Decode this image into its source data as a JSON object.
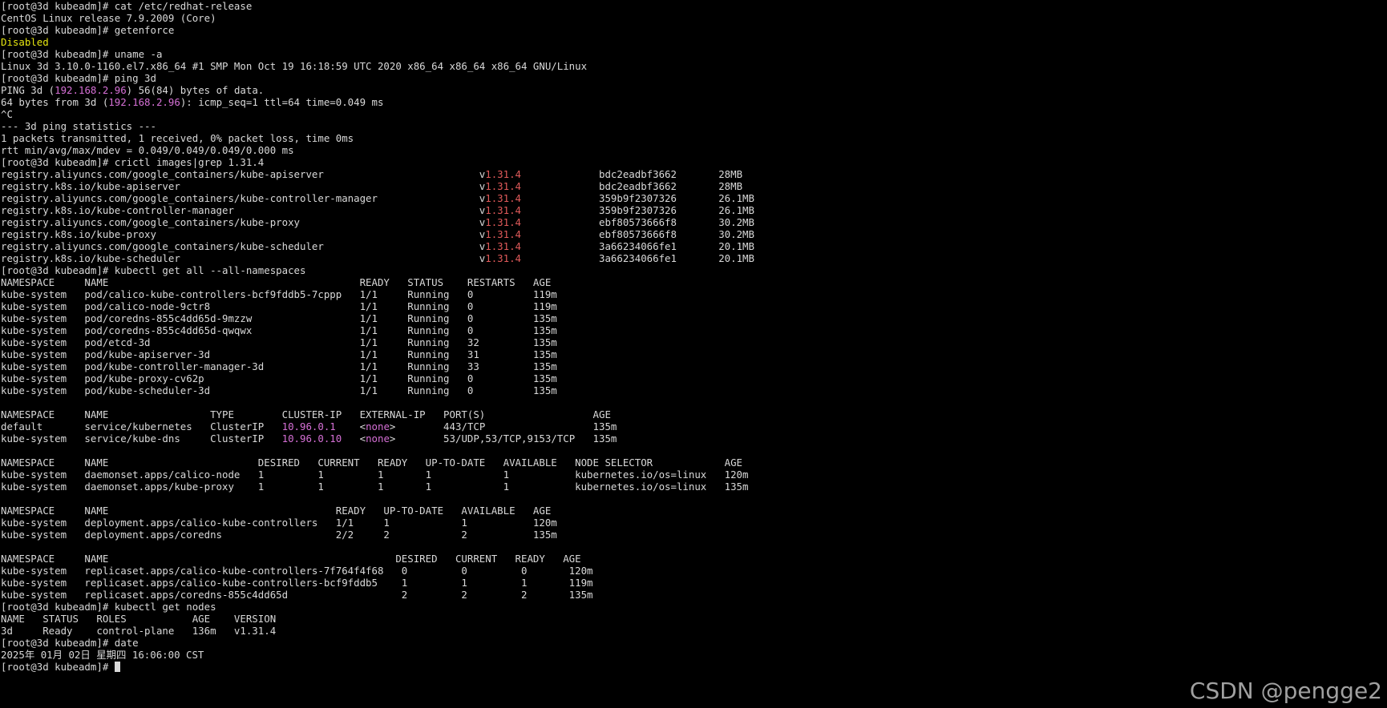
{
  "terminal": {
    "lines": [
      [
        [
          "[root@3d kubeadm]# cat /etc/redhat-release",
          ""
        ]
      ],
      [
        [
          "CentOS Linux release 7.9.2009 (Core)",
          ""
        ]
      ],
      [
        [
          "[root@3d kubeadm]# getenforce",
          ""
        ]
      ],
      [
        [
          "Disabled",
          "yellow"
        ]
      ],
      [
        [
          "[root@3d kubeadm]# uname -a",
          ""
        ]
      ],
      [
        [
          "Linux 3d 3.10.0-1160.el7.x86_64 #1 SMP Mon Oct 19 16:18:59 UTC 2020 x86_64 x86_64 x86_64 GNU/Linux",
          ""
        ]
      ],
      [
        [
          "[root@3d kubeadm]# ping 3d",
          ""
        ]
      ],
      [
        [
          "PING 3d (",
          ""
        ],
        [
          "192.168.2.96",
          "magenta"
        ],
        [
          ") 56(84) bytes of data.",
          ""
        ]
      ],
      [
        [
          "64 bytes from 3d (",
          ""
        ],
        [
          "192.168.2.96",
          "magenta"
        ],
        [
          "): icmp_seq=1 ttl=64 time=0.049 ms",
          ""
        ]
      ],
      [
        [
          "^C",
          ""
        ]
      ],
      [
        [
          "--- 3d ping statistics ---",
          ""
        ]
      ],
      [
        [
          "1 packets transmitted, 1 received, 0% packet loss, time 0ms",
          ""
        ]
      ],
      [
        [
          "rtt min/avg/max/mdev = 0.049/0.049/0.049/0.000 ms",
          ""
        ]
      ],
      [
        [
          "[root@3d kubeadm]# crictl images|grep 1.31.4",
          ""
        ]
      ],
      [
        [
          "registry.aliyuncs.com/google_containers/kube-apiserver                          v",
          ""
        ],
        [
          "1.31.4",
          "red"
        ],
        [
          "             bdc2eadbf3662       28MB",
          ""
        ]
      ],
      [
        [
          "registry.k8s.io/kube-apiserver                                                  v",
          ""
        ],
        [
          "1.31.4",
          "red"
        ],
        [
          "             bdc2eadbf3662       28MB",
          ""
        ]
      ],
      [
        [
          "registry.aliyuncs.com/google_containers/kube-controller-manager                 v",
          ""
        ],
        [
          "1.31.4",
          "red"
        ],
        [
          "             359b9f2307326       26.1MB",
          ""
        ]
      ],
      [
        [
          "registry.k8s.io/kube-controller-manager                                         v",
          ""
        ],
        [
          "1.31.4",
          "red"
        ],
        [
          "             359b9f2307326       26.1MB",
          ""
        ]
      ],
      [
        [
          "registry.aliyuncs.com/google_containers/kube-proxy                              v",
          ""
        ],
        [
          "1.31.4",
          "red"
        ],
        [
          "             ebf80573666f8       30.2MB",
          ""
        ]
      ],
      [
        [
          "registry.k8s.io/kube-proxy                                                      v",
          ""
        ],
        [
          "1.31.4",
          "red"
        ],
        [
          "             ebf80573666f8       30.2MB",
          ""
        ]
      ],
      [
        [
          "registry.aliyuncs.com/google_containers/kube-scheduler                          v",
          ""
        ],
        [
          "1.31.4",
          "red"
        ],
        [
          "             3a66234066fe1       20.1MB",
          ""
        ]
      ],
      [
        [
          "registry.k8s.io/kube-scheduler                                                  v",
          ""
        ],
        [
          "1.31.4",
          "red"
        ],
        [
          "             3a66234066fe1       20.1MB",
          ""
        ]
      ],
      [
        [
          "[root@3d kubeadm]# kubectl get all --all-namespaces",
          ""
        ]
      ],
      [
        [
          "NAMESPACE     NAME                                          READY   STATUS    RESTARTS   AGE",
          ""
        ]
      ],
      [
        [
          "kube-system   pod/calico-kube-controllers-bcf9fddb5-7cppp   1/1     Running   0          119m",
          ""
        ]
      ],
      [
        [
          "kube-system   pod/calico-node-9ctr8                         1/1     Running   0          119m",
          ""
        ]
      ],
      [
        [
          "kube-system   pod/coredns-855c4dd65d-9mzzw                  1/1     Running   0          135m",
          ""
        ]
      ],
      [
        [
          "kube-system   pod/coredns-855c4dd65d-qwqwx                  1/1     Running   0          135m",
          ""
        ]
      ],
      [
        [
          "kube-system   pod/etcd-3d                                   1/1     Running   32         135m",
          ""
        ]
      ],
      [
        [
          "kube-system   pod/kube-apiserver-3d                         1/1     Running   31         135m",
          ""
        ]
      ],
      [
        [
          "kube-system   pod/kube-controller-manager-3d                1/1     Running   33         135m",
          ""
        ]
      ],
      [
        [
          "kube-system   pod/kube-proxy-cv62p                          1/1     Running   0          135m",
          ""
        ]
      ],
      [
        [
          "kube-system   pod/kube-scheduler-3d                         1/1     Running   0          135m",
          ""
        ]
      ],
      [
        [
          "",
          ""
        ]
      ],
      [
        [
          "NAMESPACE     NAME                 TYPE        CLUSTER-IP   EXTERNAL-IP   PORT(S)                  AGE",
          ""
        ]
      ],
      [
        [
          "default       service/kubernetes   ClusterIP   ",
          ""
        ],
        [
          "10.96.0.1",
          "magenta"
        ],
        [
          "    <",
          ""
        ],
        [
          "none",
          "magenta"
        ],
        [
          ">        443/TCP                  135m",
          ""
        ]
      ],
      [
        [
          "kube-system   service/kube-dns     ClusterIP   ",
          ""
        ],
        [
          "10.96.0.10",
          "magenta"
        ],
        [
          "   <",
          ""
        ],
        [
          "none",
          "magenta"
        ],
        [
          ">        53/UDP,53/TCP,9153/TCP   135m",
          ""
        ]
      ],
      [
        [
          "",
          ""
        ]
      ],
      [
        [
          "NAMESPACE     NAME                         DESIRED   CURRENT   READY   UP-TO-DATE   AVAILABLE   NODE SELECTOR            AGE",
          ""
        ]
      ],
      [
        [
          "kube-system   daemonset.apps/calico-node   1         1         1       1            1           kubernetes.io/os=linux   120m",
          ""
        ]
      ],
      [
        [
          "kube-system   daemonset.apps/kube-proxy    1         1         1       1            1           kubernetes.io/os=linux   135m",
          ""
        ]
      ],
      [
        [
          "",
          ""
        ]
      ],
      [
        [
          "NAMESPACE     NAME                                      READY   UP-TO-DATE   AVAILABLE   AGE",
          ""
        ]
      ],
      [
        [
          "kube-system   deployment.apps/calico-kube-controllers   1/1     1            1           120m",
          ""
        ]
      ],
      [
        [
          "kube-system   deployment.apps/coredns                   2/2     2            2           135m",
          ""
        ]
      ],
      [
        [
          "",
          ""
        ]
      ],
      [
        [
          "NAMESPACE     NAME                                                DESIRED   CURRENT   READY   AGE",
          ""
        ]
      ],
      [
        [
          "kube-system   replicaset.apps/calico-kube-controllers-7f764f4f68   0         0         0       120m",
          ""
        ]
      ],
      [
        [
          "kube-system   replicaset.apps/calico-kube-controllers-bcf9fddb5    1         1         1       119m",
          ""
        ]
      ],
      [
        [
          "kube-system   replicaset.apps/coredns-855c4dd65d                   2         2         2       135m",
          ""
        ]
      ],
      [
        [
          "[root@3d kubeadm]# kubectl get nodes",
          ""
        ]
      ],
      [
        [
          "NAME   STATUS   ROLES           AGE    VERSION",
          ""
        ]
      ],
      [
        [
          "3d     Ready    control-plane   136m   v1.31.4",
          ""
        ]
      ],
      [
        [
          "[root@3d kubeadm]# date",
          ""
        ]
      ],
      [
        [
          "2025年 01月 02日 星期四 16:06:00 CST",
          ""
        ]
      ]
    ],
    "prompt": "[root@3d kubeadm]# "
  },
  "watermark": "CSDN @pengge2",
  "colors": {
    "background": "#000000",
    "foreground": "#d9d9d9",
    "yellow": "#e5e510",
    "magenta": "#d670d6",
    "red": "#e05a5a"
  }
}
